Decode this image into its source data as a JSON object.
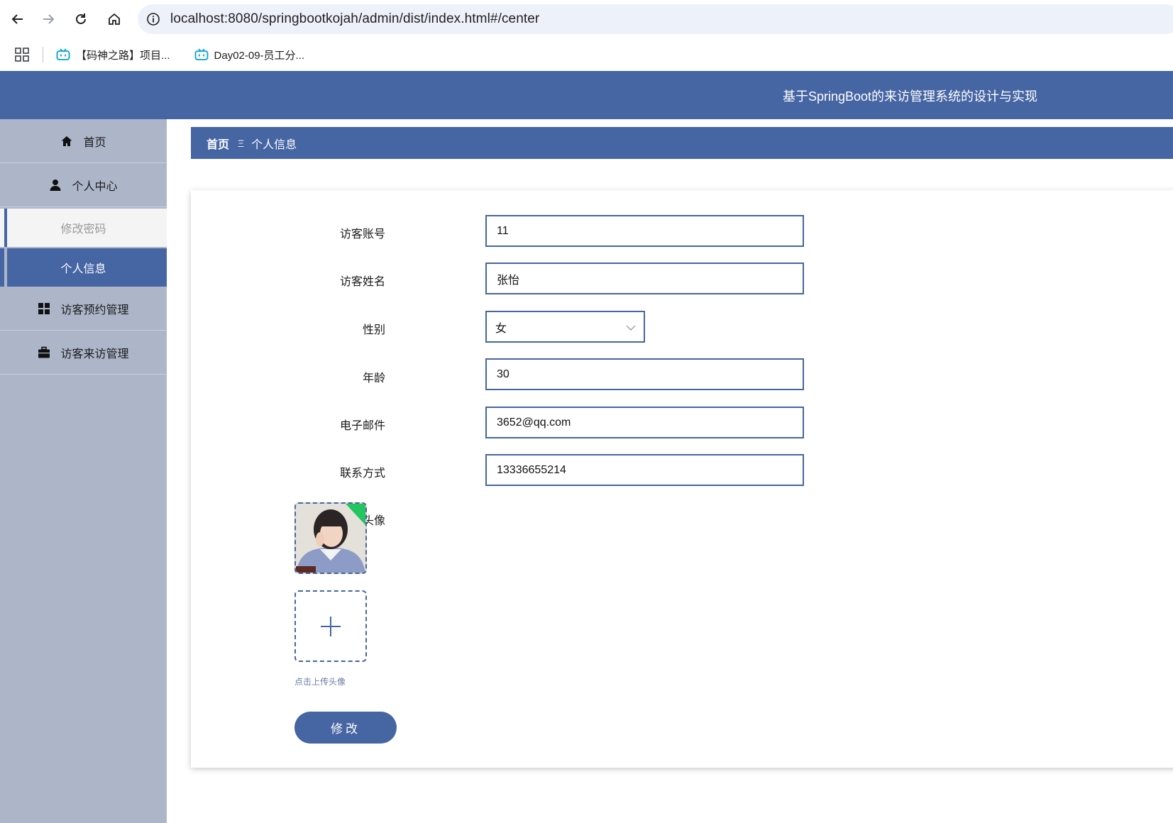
{
  "browser": {
    "url": "localhost:8080/springbootkojah/admin/dist/index.html#/center",
    "bookmarks": [
      "【码神之路】项目...",
      "Day02-09-员工分..."
    ]
  },
  "header": {
    "title": "基于SpringBoot的来访管理系统的设计与实现"
  },
  "sidebar": {
    "items": [
      {
        "label": "首页",
        "icon": "home-icon"
      },
      {
        "label": "个人中心",
        "icon": "user-icon"
      },
      {
        "label": "访客预约管理",
        "icon": "grid-icon"
      },
      {
        "label": "访客来访管理",
        "icon": "briefcase-icon"
      }
    ],
    "sub_items": [
      {
        "label": "修改密码"
      },
      {
        "label": "个人信息",
        "active": true
      }
    ]
  },
  "breadcrumb": {
    "home": "首页",
    "separator": "Ξ",
    "current": "个人信息"
  },
  "form": {
    "fields": [
      {
        "label": "访客账号",
        "value": "11"
      },
      {
        "label": "访客姓名",
        "value": "张怡"
      },
      {
        "label": "性别",
        "value": "女"
      },
      {
        "label": "年龄",
        "value": "30"
      },
      {
        "label": "电子邮件",
        "value": "3652@qq.com"
      },
      {
        "label": "联系方式",
        "value": "13336655214"
      }
    ],
    "avatar_label": "头像",
    "upload_hint": "点击上传头像",
    "submit_label": "修改"
  },
  "colors": {
    "primary": "#4665a3",
    "sidebar_bg": "#adb6c9"
  }
}
